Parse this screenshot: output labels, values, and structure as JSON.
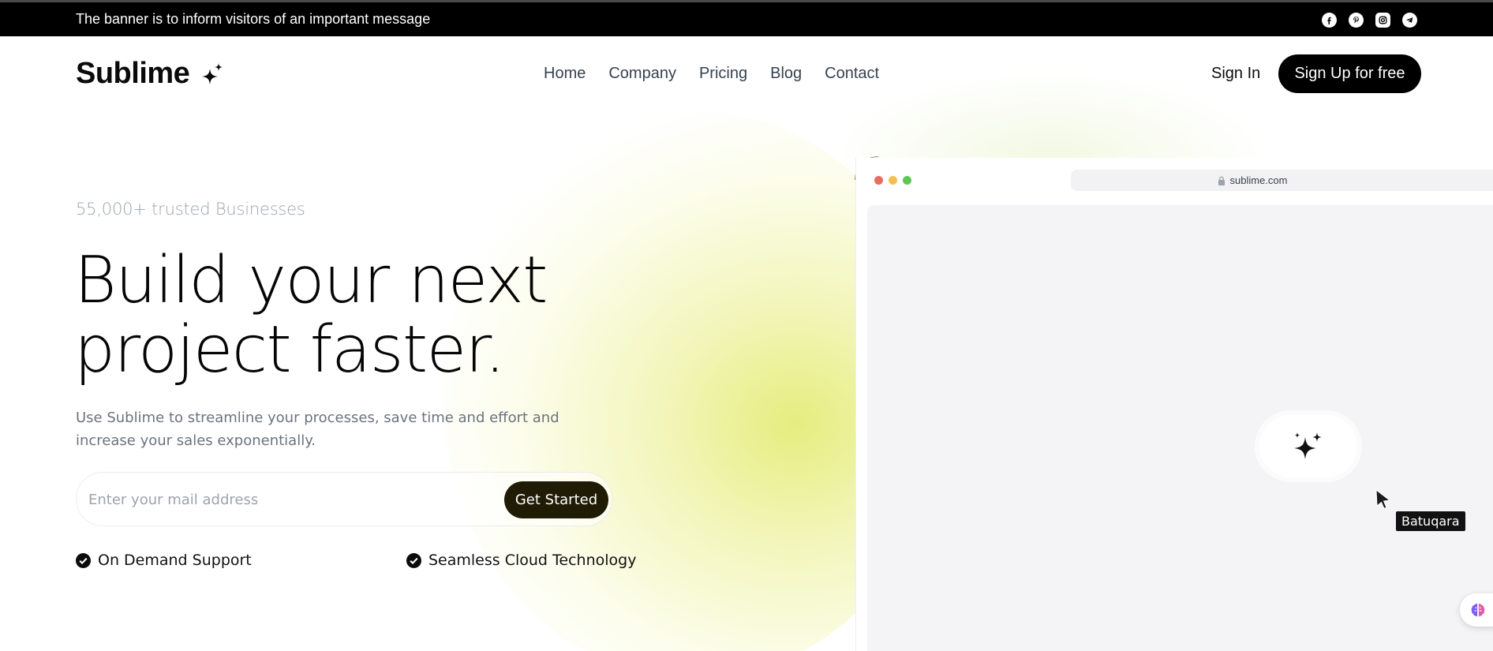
{
  "banner": {
    "message": "The banner is to inform visitors of an important message",
    "socials": [
      "facebook-icon",
      "pinterest-icon",
      "instagram-icon",
      "telegram-icon"
    ]
  },
  "header": {
    "logo_text": "Sublime",
    "logo_icon": "sparkles-icon",
    "nav": [
      "Home",
      "Company",
      "Pricing",
      "Blog",
      "Contact"
    ],
    "sign_in": "Sign In",
    "sign_up": "Sign Up for free"
  },
  "hero": {
    "trusted": "55,000+ trusted Businesses",
    "headline_line1": "Build your next",
    "headline_line2": "project faster.",
    "subtext": "Use Sublime to streamline your processes, save time and effort and increase your sales exponentially.",
    "email_placeholder": "Enter your mail address",
    "cta": "Get Started",
    "features": [
      "On Demand Support",
      "Seamless Cloud Technology"
    ]
  },
  "mockup": {
    "url": "sublime.com",
    "dot_colors": [
      "#ec6a5e",
      "#f4bf4f",
      "#61c554"
    ],
    "center_icon": "sparkles-icon",
    "tooltip": "Batuqara"
  },
  "colors": {
    "banner_bg": "#000000",
    "accent_dark": "#1f1b05",
    "glow": "#e4ec78"
  }
}
